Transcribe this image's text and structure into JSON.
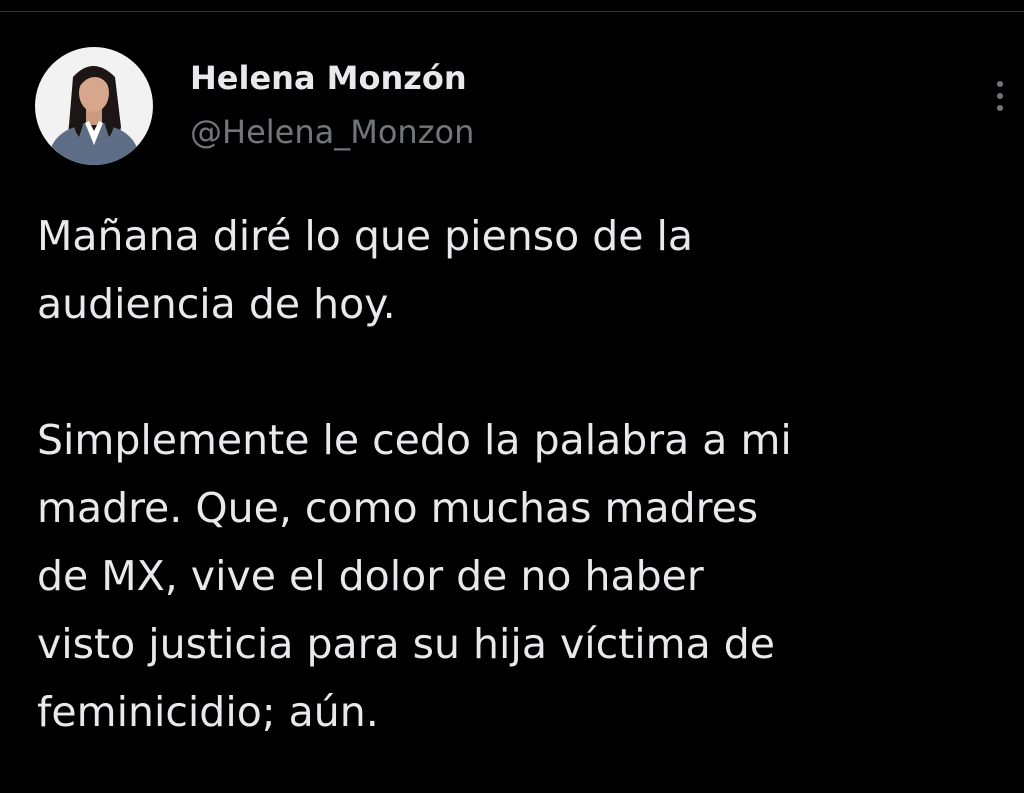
{
  "tweet": {
    "author": {
      "display_name": "Helena Monzón",
      "handle": "@Helena_Monzon",
      "avatar_icon": "profile-photo"
    },
    "more_icon": "more-vertical-icon",
    "text_lines": [
      "Mañana diré lo que pienso de la",
      "audiencia de hoy.",
      "",
      "Simplemente le cedo la palabra a mi",
      "madre. Que, como muchas madres",
      "de MX, vive el dolor de no haber",
      "visto justicia para su hija víctima de",
      "feminicidio; aún."
    ]
  },
  "colors": {
    "background": "#000000",
    "primary_text": "#e7e9ea",
    "secondary_text": "#71767b"
  }
}
